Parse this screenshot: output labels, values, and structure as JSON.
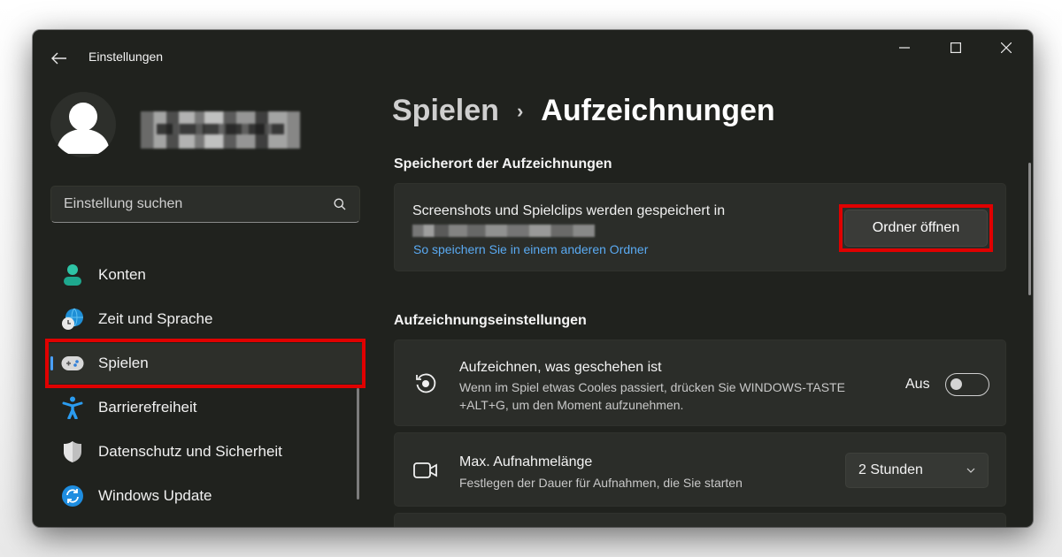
{
  "window": {
    "title": "Einstellungen",
    "controls": {
      "minimize": "minimize",
      "maximize": "maximize",
      "close": "close"
    }
  },
  "sidebar": {
    "search": {
      "placeholder": "Einstellung suchen",
      "value": ""
    },
    "items": [
      {
        "label": "Konten",
        "icon": "person-icon",
        "active": false
      },
      {
        "label": "Zeit und Sprache",
        "icon": "globe-clock-icon",
        "active": false
      },
      {
        "label": "Spielen",
        "icon": "gamepad-icon",
        "active": true
      },
      {
        "label": "Barrierefreiheit",
        "icon": "accessibility-icon",
        "active": false
      },
      {
        "label": "Datenschutz und Sicherheit",
        "icon": "shield-icon",
        "active": false
      },
      {
        "label": "Windows Update",
        "icon": "update-icon",
        "active": false
      }
    ]
  },
  "breadcrumb": {
    "parent": "Spielen",
    "separator": "›",
    "current": "Aufzeichnungen"
  },
  "sections": {
    "storage": {
      "title": "Speicherort der Aufzeichnungen",
      "description": "Screenshots und Spielclips werden gespeichert in",
      "link": "So speichern Sie in einem anderen Ordner",
      "button": "Ordner öffnen"
    },
    "settings": {
      "title": "Aufzeichnungseinstellungen",
      "rows": [
        {
          "title": "Aufzeichnen, was geschehen ist",
          "description": "Wenn im Spiel etwas Cooles passiert, drücken Sie WINDOWS-TASTE +ALT+G, um den Moment aufzunehmen.",
          "control": "toggle",
          "toggle_label": "Aus",
          "toggle_on": false
        },
        {
          "title": "Max. Aufnahmelänge",
          "description": "Festlegen der Dauer für Aufnahmen, die Sie starten",
          "control": "dropdown",
          "value": "2 Stunden"
        }
      ]
    }
  },
  "colors": {
    "accent": "#4aa1ff",
    "link": "#5aaaf2",
    "highlight": "#e00000",
    "background": "#20221e",
    "card": "#2b2d29"
  }
}
